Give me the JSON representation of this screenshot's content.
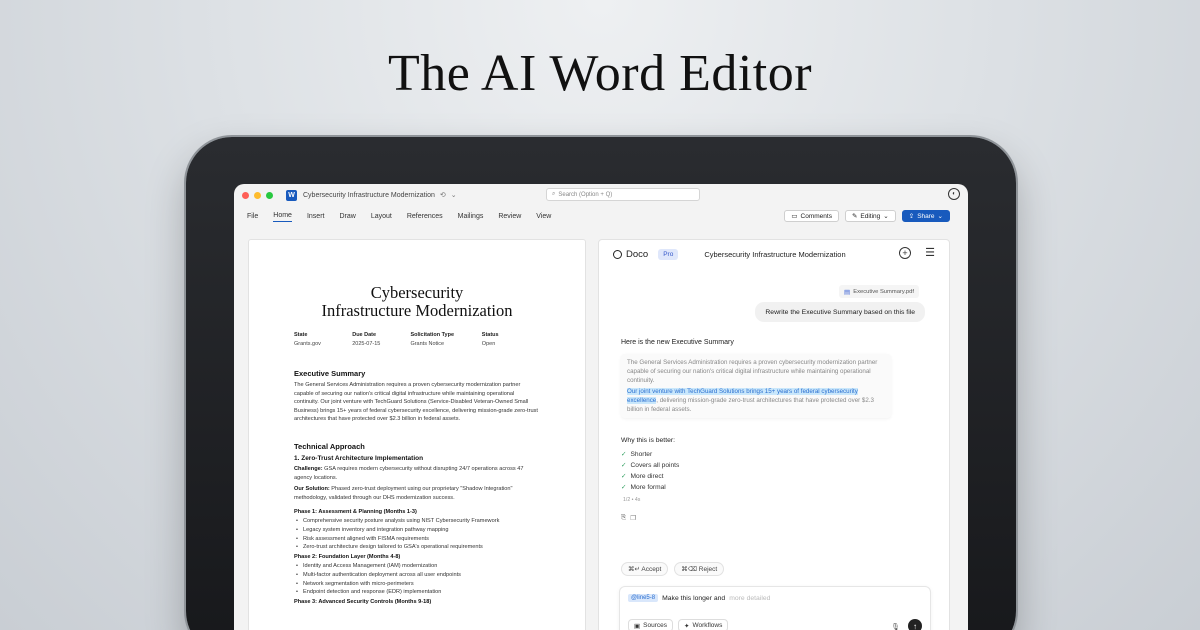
{
  "hero": {
    "title": "The AI Word Editor"
  },
  "titlebar": {
    "doc_title": "Cybersecurity Infrastructure Modernization",
    "search_placeholder": "Search (Option + Q)"
  },
  "ribbon": {
    "tabs": [
      "File",
      "Home",
      "Insert",
      "Draw",
      "Layout",
      "References",
      "Mailings",
      "Review",
      "View"
    ],
    "comments": "Comments",
    "editing": "Editing",
    "share": "Share"
  },
  "document": {
    "title_line1": "Cybersecurity",
    "title_line2": "Infrastructure Modernization",
    "meta": [
      {
        "key": "State",
        "value": "Grants.gov"
      },
      {
        "key": "Due Date",
        "value": "2025-07-15"
      },
      {
        "key": "Solicitation Type",
        "value": "Grants Notice"
      },
      {
        "key": "Status",
        "value": "Open"
      }
    ],
    "exec_heading": "Executive Summary",
    "exec_body": "The General Services Administration requires a proven cybersecurity modernization partner capable of securing our nation's critical digital infrastructure while maintaining operational continuity. Our joint venture with TechGuard Solutions (Service-Disabled Veteran-Owned Small Business) brings 15+ years of federal cybersecurity excellence, delivering mission-grade zero-trust architectures that have protected over $2.3 billion in federal assets.",
    "tech_heading": "Technical Approach",
    "zt_heading": "1. Zero-Trust Architecture Implementation",
    "challenge_label": "Challenge:",
    "challenge_text": " GSA requires modern cybersecurity without disrupting 24/7 operations across 47 agency locations.",
    "solution_label": "Our Solution:",
    "solution_text": " Phased zero-trust deployment using our proprietary \"Shadow Integration\" methodology, validated through our DHS modernization success.",
    "phase1": "Phase 1: Assessment & Planning (Months 1-3)",
    "phase1_items": [
      "Comprehensive security posture analysis using NIST Cybersecurity Framework",
      "Legacy system inventory and integration pathway mapping",
      "Risk assessment aligned with FISMA requirements",
      "Zero-trust architecture design tailored to GSA's operational requirements"
    ],
    "phase2": "Phase 2: Foundation Layer (Months 4-8)",
    "phase2_items": [
      "Identity and Access Management (IAM) modernization",
      "Multi-factor authentication deployment across all user endpoints",
      "Network segmentation with micro-perimeters",
      "Endpoint detection and response (EDR) implementation"
    ],
    "phase3": "Phase 3: Advanced Security Controls (Months 9-18)"
  },
  "chat": {
    "brand": "Doco",
    "badge": "Pro",
    "title": "Cybersecurity Infrastructure Modernization",
    "attachment": "Executive Summary.pdf",
    "user_message": "Rewrite the Executive Summary based on this file",
    "answer_heading": "Here is the new Executive Summary",
    "quote_old": "The General Services Administration requires a proven cybersecurity modernization partner capable of securing our nation's critical digital infrastructure while maintaining operational continuity.",
    "quote_highlight": "Our joint venture with TechGuard Solutions brings 15+ years of federal cybersecurity excellence",
    "quote_rest": ", delivering mission-grade zero-trust architectures that have protected over $2.3 billion in federal assets.",
    "why_heading": "Why this is better:",
    "reasons": [
      "Shorter",
      "Covers all points",
      "More direct",
      "More formal"
    ],
    "version": "1/2 • 4s",
    "accept": "⌘↵ Accept",
    "reject": "⌘⌫ Reject",
    "mention": "@line5-8",
    "compose_text": "Make this longer and",
    "compose_placeholder": "more detailed",
    "sources": "Sources",
    "workflows": "Workflows"
  },
  "icons": {
    "word": "word-app-icon",
    "search": "search-icon",
    "account": "account-icon",
    "send": "send-arrow-icon"
  },
  "colors": {
    "word_blue": "#185abd",
    "highlight": "#c9e7fb",
    "check_green": "#2f9e5f"
  }
}
